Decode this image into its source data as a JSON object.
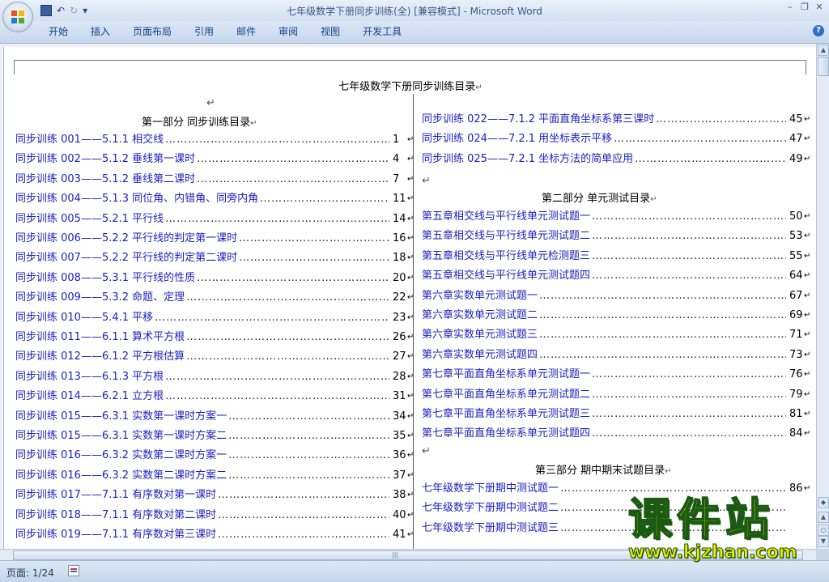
{
  "window": {
    "title": "七年级数学下册同步训练(全) [兼容模式] - Microsoft Word",
    "controls": [
      "minimize-icon",
      "restore-icon",
      "close-icon"
    ]
  },
  "quick_access": {
    "save": "save-icon",
    "undo": "↶",
    "redo": "↻",
    "more": "▾"
  },
  "ribbon": {
    "tabs": [
      "开始",
      "插入",
      "页面布局",
      "引用",
      "邮件",
      "审阅",
      "视图",
      "开发工具"
    ],
    "help": "?"
  },
  "document": {
    "title": "七年级数学下册同步训练目录",
    "para_mark": "↵",
    "left": {
      "section_heading": "第一部分    同步训练目录",
      "entries": [
        {
          "text": "同步训练 001——5.1.1 相交线",
          "page": "1"
        },
        {
          "text": "同步训练 002——5.1.2 垂线第一课时",
          "page": "4"
        },
        {
          "text": "同步训练 003——5.1.2 垂线第二课时",
          "page": "7"
        },
        {
          "text": "同步训练 004——5.1.3 同位角、内错角、同旁内角",
          "page": "11"
        },
        {
          "text": "同步训练 005——5.2.1 平行线",
          "page": "14"
        },
        {
          "text": "同步训练 006——5.2.2 平行线的判定第一课时",
          "page": "16"
        },
        {
          "text": "同步训练 007——5.2.2 平行线的判定第二课时",
          "page": "18"
        },
        {
          "text": "同步训练 008——5.3.1 平行线的性质",
          "page": "20"
        },
        {
          "text": "同步训练 009——5.3.2 命题、定理",
          "page": "22"
        },
        {
          "text": "同步训练 010——5.4.1 平移",
          "page": "23"
        },
        {
          "text": "同步训练 011——6.1.1 算术平方根",
          "page": "26"
        },
        {
          "text": "同步训练 012——6.1.2 平方根估算",
          "page": "27"
        },
        {
          "text": "同步训练 013——6.1.3 平方根",
          "page": "28"
        },
        {
          "text": "同步训练 014——6.2.1 立方根",
          "page": "31"
        },
        {
          "text": "同步训练 015——6.3.1 实数第一课时方案一",
          "page": "34"
        },
        {
          "text": "同步训练 015——6.3.1 实数第一课时方案二",
          "page": "35"
        },
        {
          "text": "同步训练 016——6.3.2 实数第二课时方案一",
          "page": "36"
        },
        {
          "text": "同步训练 016——6.3.2 实数第二课时方案二",
          "page": "37"
        },
        {
          "text": "同步训练 017——7.1.1 有序数对第一课时",
          "page": "38"
        },
        {
          "text": "同步训练 018——7.1.1 有序数对第二课时",
          "page": "40"
        },
        {
          "text": "同步训练 019——7.1.1 有序数对第三课时",
          "page": "41"
        }
      ]
    },
    "right": {
      "entries_top": [
        {
          "text": "同步训练 022——7.1.2 平面直角坐标系第三课时",
          "page": "45"
        },
        {
          "text": "同步训练 024——7.2.1 用坐标表示平移",
          "page": "47"
        },
        {
          "text": "同步训练 025——7.2.1 坐标方法的简单应用",
          "page": "49"
        }
      ],
      "section2_heading": "第二部分        单元测试目录",
      "section2_entries": [
        {
          "text": "第五章相交线与平行线单元测试题一",
          "page": "50"
        },
        {
          "text": "第五章相交线与平行线单元测试题二",
          "page": "53"
        },
        {
          "text": "第五章相交线与平行线单元检测题三",
          "page": "55"
        },
        {
          "text": "第五章相交线与平行线单元测试题四",
          "page": "64"
        },
        {
          "text": "第六章实数单元测试题一",
          "page": "67"
        },
        {
          "text": "第六章实数单元测试题二",
          "page": "69"
        },
        {
          "text": "第六章实数单元测试题三",
          "page": "71"
        },
        {
          "text": "第六章实数单元测试题四",
          "page": "73"
        },
        {
          "text": "第七章平面直角坐标系单元测试题一",
          "page": "76"
        },
        {
          "text": "第七章平面直角坐标系单元测试题二",
          "page": "79"
        },
        {
          "text": "第七章平面直角坐标系单元测试题三",
          "page": "81"
        },
        {
          "text": "第七章平面直角坐标系单元测试题四",
          "page": "84"
        }
      ],
      "section3_heading": "第三部分     期中期末试题目录",
      "section3_entries": [
        {
          "text": "七年级数学下册期中测试题一",
          "page": "86"
        },
        {
          "text": "七年级数学下册期中测试题二",
          "page": ""
        },
        {
          "text": "七年级数学下册期中测试题三",
          "page": ""
        }
      ]
    }
  },
  "statusbar": {
    "page_info": "页面: 1/24"
  },
  "watermark": {
    "logo_text": "课件站",
    "url": "www.kjzhan.com"
  }
}
